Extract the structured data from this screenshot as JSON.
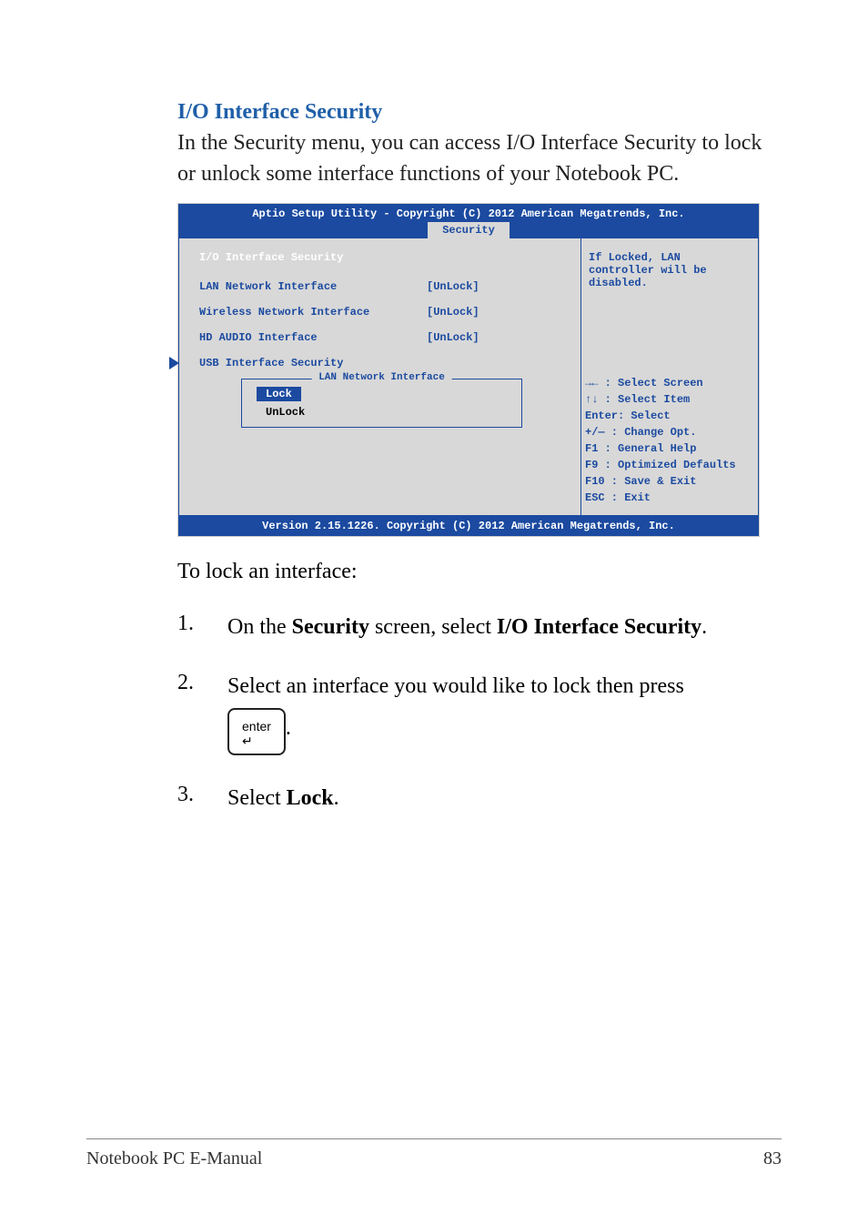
{
  "heading": "I/O Interface Security",
  "intro": "In the Security menu, you can access I/O Interface Security to lock or unlock some interface functions of your Notebook PC.",
  "bios": {
    "titlebar": "Aptio Setup Utility - Copyright (C) 2012 American Megatrends, Inc.",
    "active_tab": "Security",
    "section_title": "I/O Interface Security",
    "rows": [
      {
        "label": "LAN Network Interface",
        "value": "[UnLock]"
      },
      {
        "label": "Wireless Network Interface",
        "value": "[UnLock]"
      },
      {
        "label": "HD AUDIO Interface",
        "value": "[UnLock]"
      }
    ],
    "submenu": "USB Interface Security",
    "dropdown": {
      "title": "LAN Network Interface",
      "selected": "Lock",
      "option": "UnLock"
    },
    "help_text": "If Locked, LAN controller will be disabled.",
    "keys": {
      "k1": "→←  : Select Screen",
      "k2": "↑↓   : Select Item",
      "k3": "Enter: Select",
      "k4": "+/—  : Change Opt.",
      "k5": "F1   : General Help",
      "k6": "F9   : Optimized Defaults",
      "k7": "F10  : Save & Exit",
      "k8": "ESC  : Exit"
    },
    "footer": "Version 2.15.1226. Copyright (C) 2012 American Megatrends, Inc."
  },
  "instruction": "To lock an interface:",
  "steps": {
    "s1num": "1.",
    "s1a": "On the ",
    "s1b": "Security",
    "s1c": " screen, select ",
    "s1d": "I/O Interface Security",
    "s1e": ".",
    "s2num": "2.",
    "s2a": "Select an interface you would like to lock then press ",
    "enter_label": "enter",
    "s2b": ".",
    "s3num": "3.",
    "s3a": "Select ",
    "s3b": "Lock",
    "s3c": "."
  },
  "footer": {
    "left": "Notebook PC E-Manual",
    "right": "83"
  }
}
